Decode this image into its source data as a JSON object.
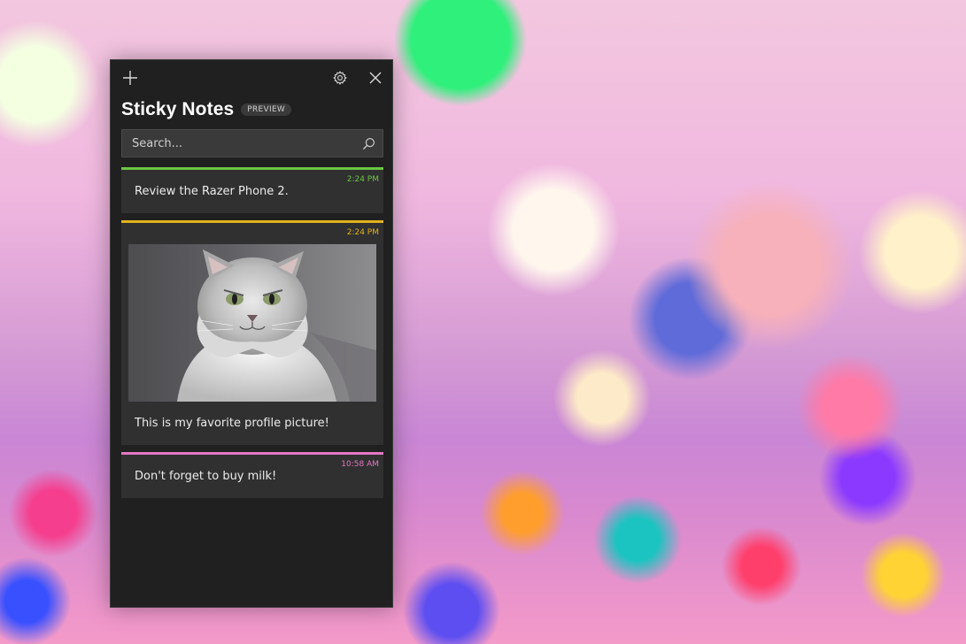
{
  "app": {
    "title": "Sticky Notes",
    "badge": "PREVIEW"
  },
  "toolbar": {
    "add_icon": "plus-icon",
    "settings_icon": "gear-icon",
    "close_icon": "close-icon"
  },
  "search": {
    "placeholder": "Search...",
    "value": "",
    "icon": "search-icon"
  },
  "notes": [
    {
      "time": "2:24 PM",
      "text": "Review the Razer Phone 2.",
      "color": "#6cc644"
    },
    {
      "time": "2:24 PM",
      "text": "This is my favorite profile picture!",
      "color": "#e2b21d",
      "image": "cat-photo"
    },
    {
      "time": "10:58 AM",
      "text": "Don't forget to buy milk!",
      "color": "#e278c4"
    }
  ],
  "colors": {
    "window_bg": "#202020",
    "note_bg": "#303030",
    "search_bg": "#3a3a3a"
  }
}
